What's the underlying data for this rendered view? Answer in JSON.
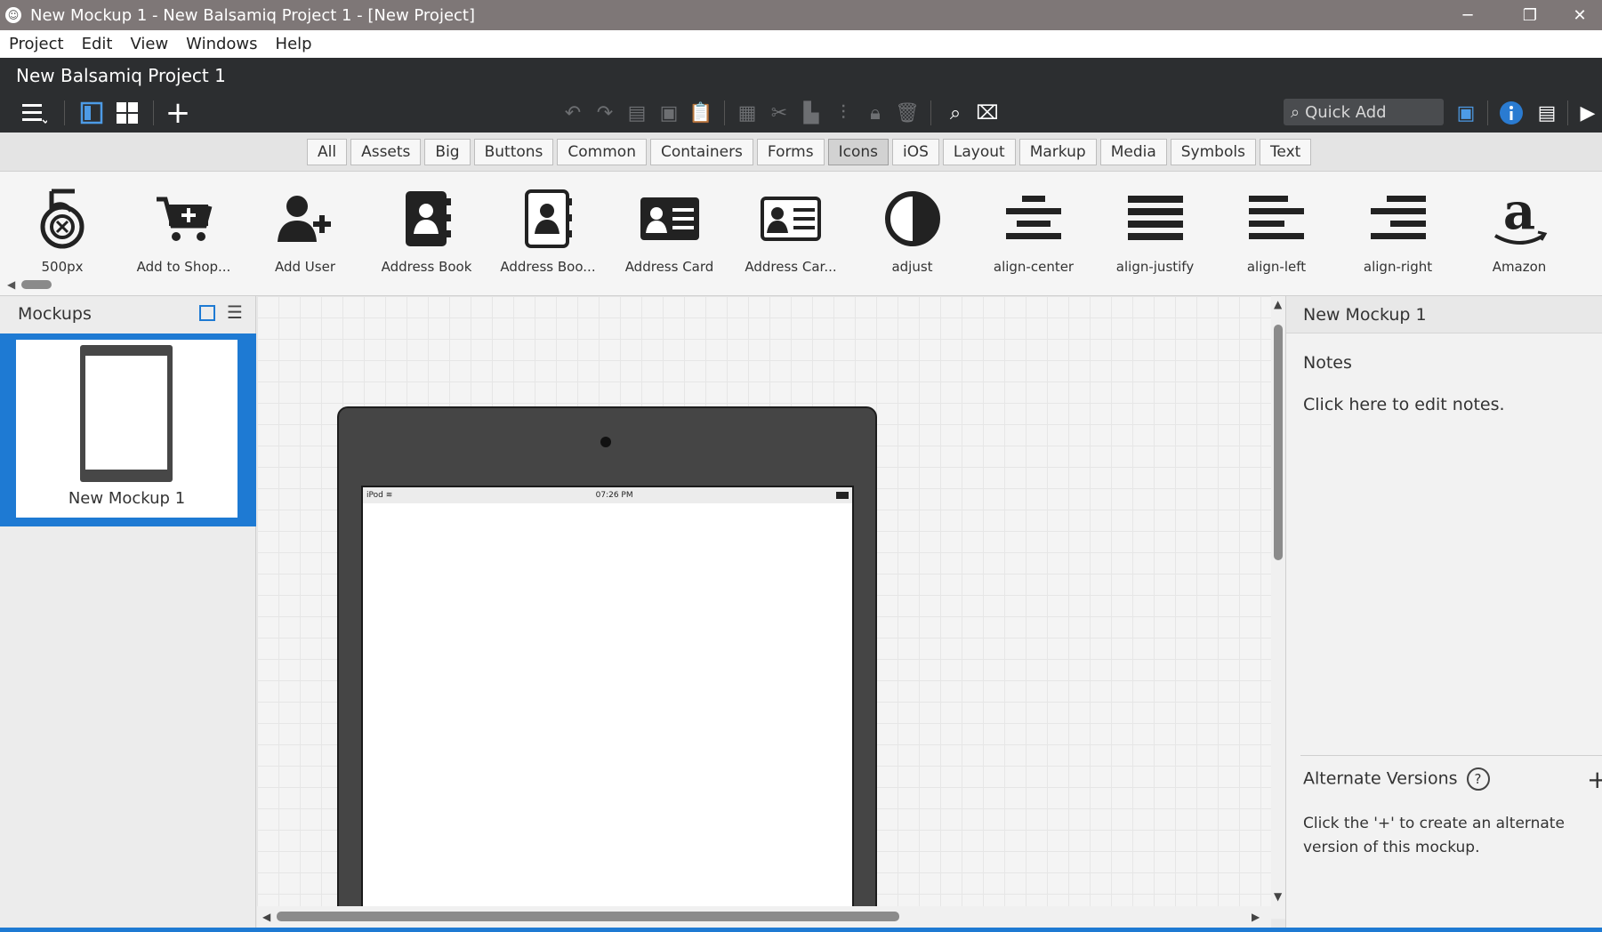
{
  "window": {
    "title": "New Mockup 1 - New Balsamiq Project 1 - [New Project]"
  },
  "menu": [
    "Project",
    "Edit",
    "View",
    "Windows",
    "Help"
  ],
  "project": {
    "title": "New Balsamiq Project 1"
  },
  "toolbar": {
    "quick_add_placeholder": "Quick Add"
  },
  "filters": {
    "items": [
      "All",
      "Assets",
      "Big",
      "Buttons",
      "Common",
      "Containers",
      "Forms",
      "Icons",
      "iOS",
      "Layout",
      "Markup",
      "Media",
      "Symbols",
      "Text"
    ],
    "active": "Icons"
  },
  "library": {
    "items": [
      {
        "label": "500px",
        "icon": "500px-icon"
      },
      {
        "label": "Add to Shop...",
        "icon": "cart-plus-icon"
      },
      {
        "label": "Add User",
        "icon": "user-plus-icon"
      },
      {
        "label": "Address Book",
        "icon": "address-book-icon"
      },
      {
        "label": "Address Boo...",
        "icon": "address-book-outline-icon"
      },
      {
        "label": "Address Card",
        "icon": "address-card-icon"
      },
      {
        "label": "Address Car...",
        "icon": "address-card-outline-icon"
      },
      {
        "label": "adjust",
        "icon": "adjust-icon"
      },
      {
        "label": "align-center",
        "icon": "align-center-icon"
      },
      {
        "label": "align-justify",
        "icon": "align-justify-icon"
      },
      {
        "label": "align-left",
        "icon": "align-left-icon"
      },
      {
        "label": "align-right",
        "icon": "align-right-icon"
      },
      {
        "label": "Amazon",
        "icon": "amazon-icon"
      }
    ]
  },
  "mockups_panel": {
    "title": "Mockups",
    "items": [
      {
        "label": "New Mockup 1",
        "selected": true
      }
    ]
  },
  "canvas": {
    "device": {
      "status_left": "iPod",
      "status_time": "07:26 PM"
    }
  },
  "inspector": {
    "title": "New Mockup 1",
    "notes_heading": "Notes",
    "notes_placeholder": "Click here to edit notes.",
    "alternate_heading": "Alternate Versions",
    "alternate_help": "?",
    "alternate_text_line1": "Click the '+' to create an alternate",
    "alternate_text_line2": "version of this mockup."
  },
  "colors": {
    "selection": "#1e7ad3",
    "toolbar_bg": "#2c2e30",
    "titlebar_bg": "#7e7777"
  }
}
